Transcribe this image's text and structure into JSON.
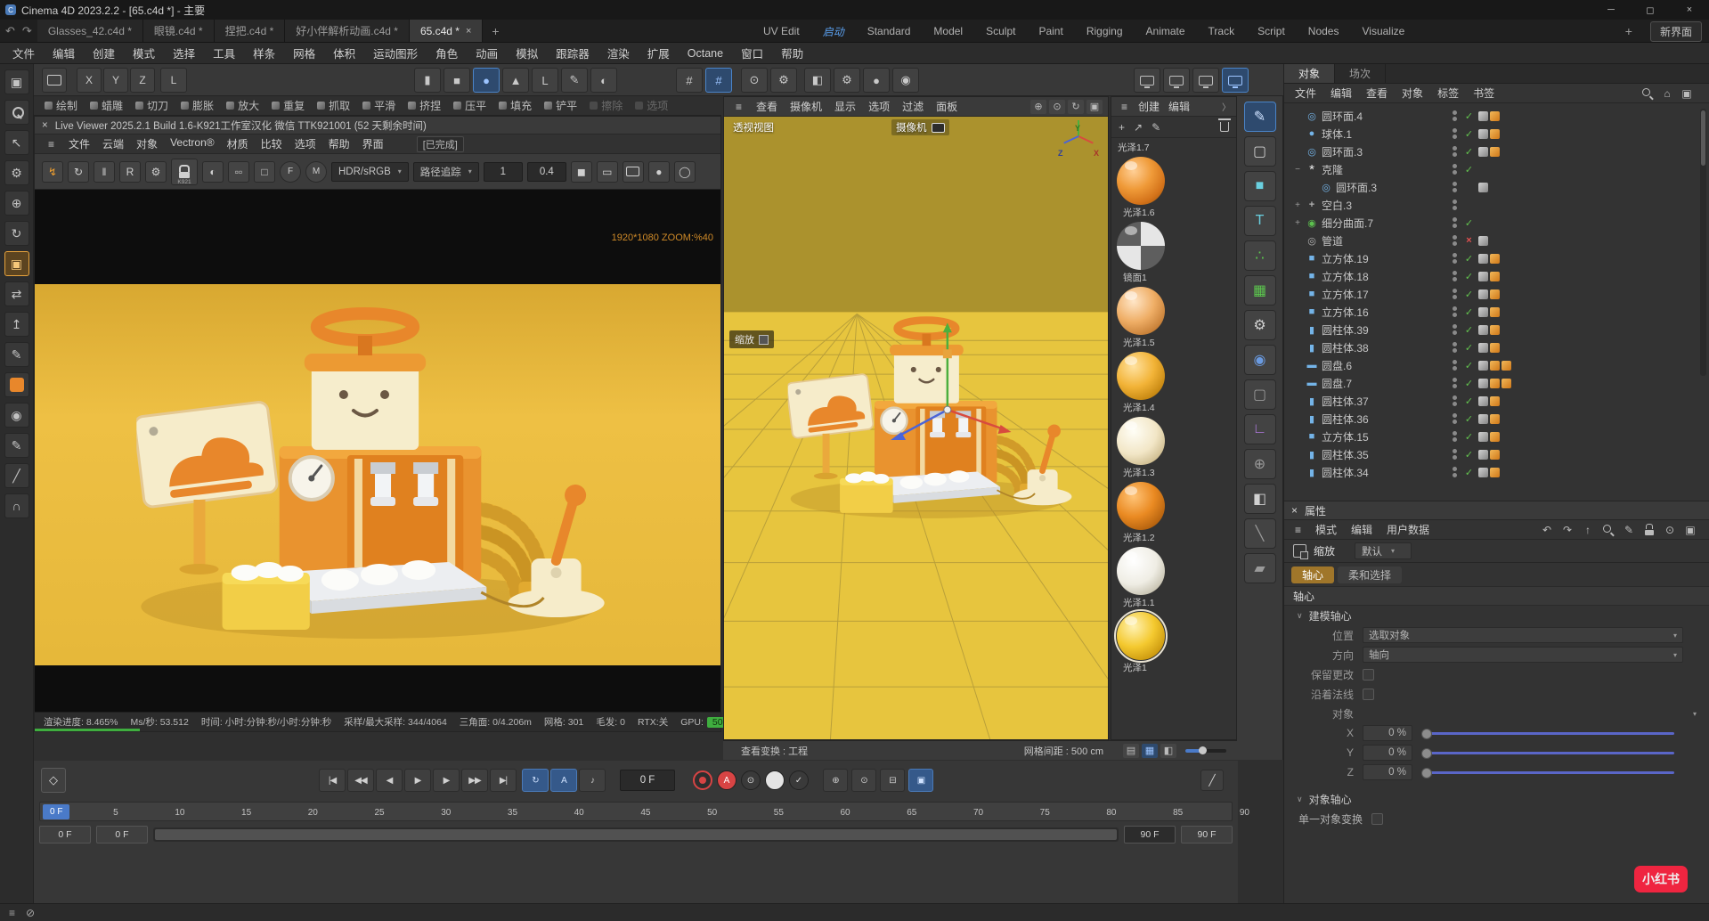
{
  "titlebar": {
    "title": "Cinema 4D 2023.2.2 - [65.c4d *] - 主要",
    "app_letter": "C"
  },
  "icons": {
    "close": "×",
    "minimize": "─",
    "maximize": "◻",
    "undo": "↶",
    "redo": "↷",
    "hamburger": "≡",
    "dropdown": "▾",
    "overflow": "〉",
    "add": "+",
    "export": "↗",
    "pencil": "✎",
    "caret_down": "∨",
    "home": "⌂",
    "panel": "▣",
    "snap": "#",
    "axis_l": "L",
    "slash": "╱"
  },
  "doc_tabs": {
    "tabs": [
      {
        "label": "Glasses_42.c4d *"
      },
      {
        "label": "眼镜.c4d *"
      },
      {
        "label": "捏把.c4d *"
      },
      {
        "label": "好小伴解析动画.c4d *"
      },
      {
        "label": "65.c4d *",
        "active": true
      }
    ],
    "add": "+"
  },
  "layout_tabs": {
    "tabs": [
      {
        "label": "UV Edit"
      },
      {
        "label": "启动",
        "active": true
      },
      {
        "label": "Standard"
      },
      {
        "label": "Model"
      },
      {
        "label": "Sculpt"
      },
      {
        "label": "Paint"
      },
      {
        "label": "Rigging"
      },
      {
        "label": "Animate"
      },
      {
        "label": "Track"
      },
      {
        "label": "Script"
      },
      {
        "label": "Nodes"
      },
      {
        "label": "Visualize"
      }
    ],
    "add": "+",
    "new_layout": "新界面"
  },
  "menubar": {
    "items": [
      "文件",
      "编辑",
      "创建",
      "模式",
      "选择",
      "工具",
      "样条",
      "网格",
      "体积",
      "运动图形",
      "角色",
      "动画",
      "模拟",
      "跟踪器",
      "渲染",
      "扩展",
      "Octane",
      "窗口",
      "帮助"
    ]
  },
  "toolbar": {
    "axis_x": "X",
    "axis_y": "Y",
    "axis_z": "Z",
    "workplane": "L",
    "mode_icons": [
      {
        "name": "cylinder-tool-icon",
        "glyph": "▮"
      },
      {
        "name": "cube-tool-icon",
        "glyph": "■"
      },
      {
        "name": "sphere-tool-icon",
        "glyph": "●",
        "active": true
      },
      {
        "name": "cone-tool-icon",
        "glyph": "▲"
      },
      {
        "name": "spline-l-icon",
        "glyph": "L"
      },
      {
        "name": "pen-tool-icon",
        "glyph": "✎"
      },
      {
        "name": "material-ball-icon",
        "glyph": "◐"
      }
    ],
    "snap_icons": [
      {
        "name": "snap-toggle-icon",
        "glyph": "#"
      },
      {
        "name": "snap-settings-icon",
        "glyph": "#",
        "active": true
      }
    ],
    "misc_icons": [
      {
        "name": "viewport-options-icon",
        "glyph": "⊙"
      },
      {
        "name": "project-settings-icon",
        "glyph": "⚙"
      }
    ],
    "render_icons": [
      {
        "name": "render-view-icon",
        "glyph": "◧"
      },
      {
        "name": "render-settings-icon",
        "glyph": "⚙"
      },
      {
        "name": "render-button-icon",
        "glyph": "●"
      },
      {
        "name": "render-pv-button-icon",
        "glyph": "◉"
      }
    ],
    "display_icons": [
      {
        "name": "display-1-icon"
      },
      {
        "name": "display-2-icon"
      },
      {
        "name": "display-3-icon"
      },
      {
        "name": "display-4-icon",
        "active": true
      }
    ]
  },
  "brushbar": {
    "items": [
      {
        "label": "绘制"
      },
      {
        "label": "蜡雕"
      },
      {
        "label": "切刀"
      },
      {
        "label": "膨胀"
      },
      {
        "label": "放大"
      },
      {
        "label": "重复"
      },
      {
        "label": "抓取"
      },
      {
        "label": "平滑"
      },
      {
        "label": "挤捏"
      },
      {
        "label": "压平"
      },
      {
        "label": "填充"
      },
      {
        "label": "铲平"
      },
      {
        "label": "擦除",
        "disabled": true
      },
      {
        "label": "选项",
        "disabled": true
      }
    ]
  },
  "leftstrip": {
    "items": [
      {
        "name": "viewport-frame-icon",
        "glyph": "▣"
      },
      {
        "name": "magnify-icon",
        "kind": "search"
      },
      {
        "name": "select-arrow-icon",
        "glyph": "↖"
      },
      {
        "name": "mode-settings-icon",
        "glyph": "⚙"
      },
      {
        "name": "move-tool-icon",
        "glyph": "⊕"
      },
      {
        "name": "rotate-tool-icon",
        "glyph": "↻"
      },
      {
        "name": "scale-tool-icon",
        "glyph": "▣",
        "active": true
      },
      {
        "name": "mirror-tool-icon",
        "glyph": "⇄"
      },
      {
        "name": "extrude-tool-icon",
        "glyph": "↥"
      },
      {
        "name": "brush-tool-icon",
        "glyph": "✎"
      },
      {
        "name": "color-swatch",
        "kind": "swatch"
      },
      {
        "name": "sphere-pair-icon",
        "glyph": "◉"
      },
      {
        "name": "paint-tool-icon",
        "glyph": "✎"
      },
      {
        "name": "knife-tool-icon",
        "glyph": "╱"
      },
      {
        "name": "magnet-tool-icon",
        "glyph": "∩"
      }
    ]
  },
  "octane": {
    "close": "×",
    "title": "Live Viewer 2025.2.1 Build 1.6-K921工作室汉化 微信 TTK921001 (52 天剩余时间)",
    "menu": [
      "文件",
      "云端",
      "对象",
      "Vectron®",
      "材质",
      "比较",
      "选项",
      "帮助",
      "界面"
    ],
    "done_chip": "[已完成]",
    "tools": [
      {
        "name": "restart-render-icon",
        "glyph": "↯",
        "cls": "orange"
      },
      {
        "name": "refresh-icon",
        "glyph": "↻"
      },
      {
        "name": "pause-icon",
        "glyph": "‖"
      },
      {
        "name": "reset-icon",
        "glyph": "R",
        "cls": "boxed"
      },
      {
        "name": "kernel-gear-icon",
        "glyph": "⚙"
      },
      {
        "name": "license-lock-icon",
        "kind": "lock",
        "label": "K921"
      },
      {
        "name": "preview-mode-icon",
        "glyph": "◐"
      },
      {
        "name": "subsample-icon",
        "glyph": "▫▫"
      },
      {
        "name": "region-render-icon",
        "glyph": "□"
      },
      {
        "name": "focus-picker-icon",
        "glyph": "F",
        "cls": "circled"
      },
      {
        "name": "material-picker-icon",
        "glyph": "M",
        "cls": "circled"
      }
    ],
    "colorspace": "HDR/sRGB",
    "kernel": "路径追踪",
    "field1": "1",
    "field2": "0.4",
    "tools2": [
      {
        "name": "clay-mode-icon",
        "glyph": "◼"
      },
      {
        "name": "filmstrip-icon",
        "glyph": "▭"
      },
      {
        "name": "camera-icon",
        "kind": "cam"
      },
      {
        "name": "save-dot-icon",
        "glyph": "●"
      },
      {
        "name": "ab-compare-icon",
        "glyph": "◯"
      }
    ],
    "overlay": "1920*1080 ZOOM:%40",
    "status": [
      "渲染进度: 8.465%",
      "Ms/秒: 53.512",
      "时间: 小时:分钟:秒/小时:分钟:秒",
      "采样/最大采样: 344/4064",
      "三角面: 0/4.206m",
      "网格: 301",
      "毛发: 0",
      "RTX:关"
    ],
    "gpu_label": "GPU:",
    "gpu_value": "50"
  },
  "viewport": {
    "menu": [
      "查看",
      "摄像机",
      "显示",
      "选项",
      "过滤",
      "面板"
    ],
    "nav_icons": [
      {
        "name": "pan-icon",
        "glyph": "⊕"
      },
      {
        "name": "dolly-icon",
        "glyph": "⊙"
      },
      {
        "name": "orbit-icon",
        "glyph": "↻"
      },
      {
        "name": "toggle-view-icon",
        "glyph": "▣"
      }
    ],
    "view_label": "透视视图",
    "camera_label": "摄像机",
    "zoom_label": "缩放",
    "axis": {
      "x": "X",
      "y": "Y",
      "z": "Z"
    },
    "transform_info": "查看变换 : 工程",
    "grid_info": "网格间距 : 500 cm",
    "bottom_icons": [
      {
        "name": "list-view-icon",
        "glyph": "▤"
      },
      {
        "name": "grid-view-icon",
        "glyph": "▦",
        "active": true
      },
      {
        "name": "split-view-icon",
        "glyph": "◧"
      }
    ]
  },
  "materials": {
    "menu": [
      "创建",
      "编辑"
    ],
    "partial_label": "光泽1.7",
    "items": [
      {
        "name": "光泽1.6",
        "kind": "glossy-orange"
      },
      {
        "name": "镜面1",
        "kind": "mirror"
      },
      {
        "name": "光泽1.5",
        "kind": "glossy-peach"
      },
      {
        "name": "光泽1.4",
        "kind": "glossy-amber"
      },
      {
        "name": "光泽1.3",
        "kind": "glossy-cream"
      },
      {
        "name": "光泽1.2",
        "kind": "glossy-orange2"
      },
      {
        "name": "光泽1.1",
        "kind": "glossy-white"
      },
      {
        "name": "光泽1",
        "kind": "glossy-yellow",
        "selected": true
      }
    ]
  },
  "iconstrip": {
    "items": [
      {
        "name": "spline-pen-icon",
        "glyph": "✎",
        "cls": "active"
      },
      {
        "name": "shape-rect-icon",
        "glyph": "▢"
      },
      {
        "name": "primitive-cube-icon",
        "glyph": "■",
        "cls": "cyan"
      },
      {
        "name": "text-tool-icon",
        "glyph": "T",
        "cls": "cyan"
      },
      {
        "name": "cloner-icon",
        "glyph": "∴",
        "cls": "green"
      },
      {
        "name": "matrix-icon",
        "glyph": "▦",
        "cls": "green"
      },
      {
        "name": "deformer-gear-icon",
        "glyph": "⚙"
      },
      {
        "name": "field-sphere-icon",
        "glyph": "◉",
        "cls": "blue"
      },
      {
        "name": "volume-cube-icon",
        "glyph": "▢",
        "cls": "dim"
      },
      {
        "name": "axis-corner-icon",
        "glyph": "∟",
        "cls": "purple"
      },
      {
        "name": "environment-icon",
        "glyph": "⊕",
        "cls": "dim"
      },
      {
        "name": "camera-clap-icon",
        "glyph": "◧"
      },
      {
        "name": "wrench-icon",
        "glyph": "╲",
        "cls": "dim"
      },
      {
        "name": "eraser-icon",
        "glyph": "▰",
        "cls": "dim"
      }
    ]
  },
  "object_panel": {
    "tabs": [
      {
        "label": "对象",
        "active": true
      },
      {
        "label": "场次"
      }
    ],
    "menu": [
      "文件",
      "编辑",
      "查看",
      "对象",
      "标签",
      "书签"
    ],
    "nav_icons": [
      {
        "name": "find-object-icon",
        "kind": "search"
      },
      {
        "name": "home-icon",
        "glyph": "⌂"
      },
      {
        "name": "panel-layout-icon",
        "glyph": "▣"
      }
    ],
    "rows": [
      {
        "name": "圆环面.4",
        "icon": "torus",
        "state": "check",
        "tags": [
          "phong",
          "mat"
        ]
      },
      {
        "name": "球体.1",
        "icon": "sphere",
        "state": "check",
        "tags": [
          "phong",
          "mat"
        ]
      },
      {
        "name": "圆环面.3",
        "icon": "torus",
        "state": "check",
        "tags": [
          "phong",
          "mat"
        ]
      },
      {
        "name": "克隆",
        "icon": "clone",
        "expand": "minus",
        "state": "check",
        "tags": []
      },
      {
        "name": "圆环面.3",
        "icon": "torus",
        "indent": "1",
        "state": "none",
        "tags": [
          "phong"
        ]
      },
      {
        "name": "空白.3",
        "icon": "null",
        "expand": "plus",
        "state": "none",
        "tags": []
      },
      {
        "name": "细分曲面.7",
        "icon": "subdiv",
        "expand": "plus",
        "state": "check",
        "tags": []
      },
      {
        "name": "管道",
        "icon": "pipe",
        "state": "cross",
        "tags": [
          "phong"
        ]
      },
      {
        "name": "立方体.19",
        "icon": "cube",
        "state": "check",
        "tags": [
          "phong",
          "mat"
        ]
      },
      {
        "name": "立方体.18",
        "icon": "cube",
        "state": "check",
        "tags": [
          "phong",
          "mat"
        ]
      },
      {
        "name": "立方体.17",
        "icon": "cube",
        "state": "check",
        "tags": [
          "phong",
          "mat"
        ]
      },
      {
        "name": "立方体.16",
        "icon": "cube",
        "state": "check",
        "tags": [
          "phong",
          "mat"
        ]
      },
      {
        "name": "圆柱体.39",
        "icon": "cylinder",
        "state": "check",
        "tags": [
          "phong",
          "mat"
        ]
      },
      {
        "name": "圆柱体.38",
        "icon": "cylinder",
        "state": "check",
        "tags": [
          "phong",
          "mat"
        ]
      },
      {
        "name": "圆盘.6",
        "icon": "disc",
        "state": "check",
        "tags": [
          "phong",
          "mat",
          "mat"
        ]
      },
      {
        "name": "圆盘.7",
        "icon": "disc",
        "state": "check",
        "tags": [
          "phong",
          "mat",
          "mat"
        ]
      },
      {
        "name": "圆柱体.37",
        "icon": "cylinder",
        "state": "check",
        "tags": [
          "phong",
          "mat"
        ]
      },
      {
        "name": "圆柱体.36",
        "icon": "cylinder",
        "state": "check",
        "tags": [
          "phong",
          "mat"
        ]
      },
      {
        "name": "立方体.15",
        "icon": "cube",
        "state": "check",
        "tags": [
          "phong",
          "mat"
        ]
      },
      {
        "name": "圆柱体.35",
        "icon": "cylinder",
        "state": "check",
        "tags": [
          "phong",
          "mat"
        ]
      },
      {
        "name": "圆柱体.34",
        "icon": "cylinder",
        "state": "check",
        "tags": [
          "phong",
          "mat"
        ]
      }
    ]
  },
  "attributes": {
    "close": "×",
    "title": "属性",
    "menu": [
      "模式",
      "编辑",
      "用户数据"
    ],
    "nav_icons": [
      {
        "name": "back-icon",
        "glyph": "↶"
      },
      {
        "name": "forward-icon",
        "glyph": "↷"
      },
      {
        "name": "up-icon",
        "glyph": "↑"
      },
      {
        "name": "search-icon",
        "kind": "search"
      },
      {
        "name": "edit-icon",
        "glyph": "✎"
      },
      {
        "name": "lock-icon",
        "kind": "lock2"
      },
      {
        "name": "target-icon",
        "glyph": "⊙"
      },
      {
        "name": "panel-icon",
        "glyph": "▣"
      }
    ],
    "tool_label": "缩放",
    "preset_label": "默认",
    "tabs": [
      {
        "label": "轴心",
        "active": true
      },
      {
        "label": "柔和选择"
      }
    ],
    "section": "轴心",
    "groups": [
      {
        "title": "建模轴心",
        "rows": [
          {
            "label": "位置",
            "type": "select",
            "value": "选取对象"
          },
          {
            "label": "方向",
            "type": "select",
            "value": "轴向"
          },
          {
            "label": "保留更改",
            "type": "checkbox"
          },
          {
            "label": "沿着法线",
            "type": "checkbox"
          },
          {
            "label": "对象",
            "type": "objsel",
            "value": ""
          },
          {
            "label": "X",
            "type": "slider",
            "value": "0 %"
          },
          {
            "label": "Y",
            "type": "slider",
            "value": "0 %"
          },
          {
            "label": "Z",
            "type": "slider",
            "value": "0 %"
          }
        ]
      },
      {
        "title": "对象轴心",
        "rows": [
          {
            "label": "单一对象变换",
            "type": "checkbox2"
          }
        ]
      }
    ]
  },
  "timeline": {
    "keyframe_glyph": "◇",
    "playback": [
      {
        "name": "go-start-button",
        "glyph": "|◀"
      },
      {
        "name": "prev-key-button",
        "glyph": "◀◀"
      },
      {
        "name": "prev-frame-button",
        "glyph": "◀"
      },
      {
        "name": "play-button",
        "glyph": "▶"
      },
      {
        "name": "next-frame-button",
        "glyph": "▶"
      },
      {
        "name": "next-key-button",
        "glyph": "▶▶"
      },
      {
        "name": "go-end-button",
        "glyph": "▶|"
      }
    ],
    "toggles": [
      {
        "name": "loop-button",
        "glyph": "↻",
        "active": true
      },
      {
        "name": "autokey-a-button",
        "glyph": "A",
        "active": true
      },
      {
        "name": "sound-button",
        "glyph": "♪"
      }
    ],
    "frame_field": "0 F",
    "records": [
      {
        "name": "record-keyframe-button",
        "kind": "ring-red"
      },
      {
        "name": "record-auto-button",
        "kind": "solid-red",
        "glyph": "A"
      },
      {
        "name": "record-param-button",
        "kind": "dark",
        "glyph": "⊙"
      },
      {
        "name": "record-point-button",
        "kind": "light"
      },
      {
        "name": "record-check-button",
        "kind": "dark",
        "glyph": "✓"
      }
    ],
    "transform_icons": [
      {
        "name": "key-position-icon",
        "glyph": "⊕"
      },
      {
        "name": "key-scale-icon",
        "glyph": "⊙"
      },
      {
        "name": "key-rotation-icon",
        "glyph": "⊟"
      },
      {
        "name": "key-preset-icon",
        "glyph": "▣",
        "active": true
      }
    ],
    "curve_glyph": "╱",
    "marker_label": "0 F",
    "ticks": [
      "0",
      "5",
      "10",
      "15",
      "20",
      "25",
      "30",
      "35",
      "40",
      "45",
      "50",
      "55",
      "60",
      "65",
      "70",
      "75",
      "80",
      "85",
      "90"
    ],
    "range_start_a": "0 F",
    "range_start_b": "0 F",
    "range_end_a": "90 F",
    "range_end_b": "90 F"
  },
  "statusbar": {
    "icons": [
      {
        "name": "status-menu-icon",
        "glyph": "≡"
      },
      {
        "name": "status-check-icon",
        "glyph": "⊘"
      }
    ]
  },
  "watermark": "小红书"
}
